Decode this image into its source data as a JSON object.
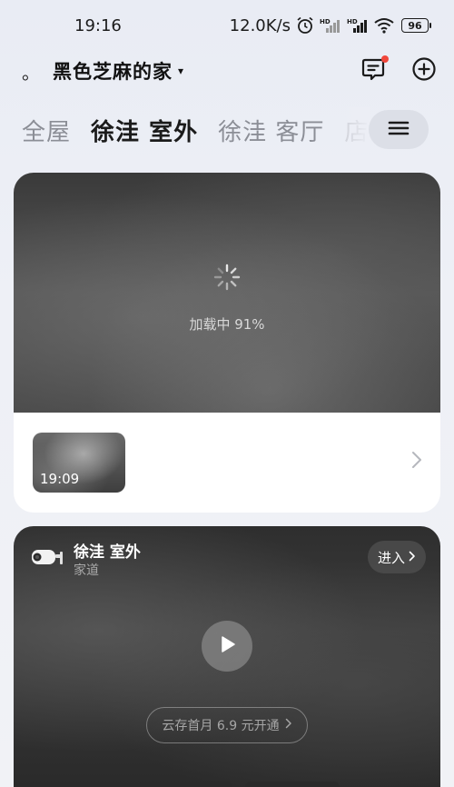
{
  "status_bar": {
    "time": "19:16",
    "net_speed": "12.0K/s",
    "battery": "96",
    "icons": [
      "alarm-icon",
      "signal-hd-icon",
      "signal-hd-icon",
      "wifi-icon",
      "battery-icon"
    ]
  },
  "header": {
    "dot": "。",
    "home_name": "黑色芝麻的家",
    "caret": "▾",
    "icons": [
      "message-icon",
      "add-icon"
    ]
  },
  "tabs": [
    {
      "label": "全屋"
    },
    {
      "label": "徐洼 室外"
    },
    {
      "label": "徐洼 客厅"
    },
    {
      "label": "店"
    }
  ],
  "active_tab": "徐洼 室外",
  "card1": {
    "loading_text": "加载中 91%",
    "loading_progress": 0.91,
    "clip_time": "19:09"
  },
  "card2": {
    "camera_name": "徐洼 室外",
    "camera_location": "家道",
    "enter_label": "进入",
    "cloud_promo": "云存首月 6.9 元开通"
  },
  "colors": {
    "background": "#eceef5",
    "notification_dot": "#f0473b",
    "active_tab": "#1b1b1b",
    "inactive_tab": "#8b8e96"
  }
}
